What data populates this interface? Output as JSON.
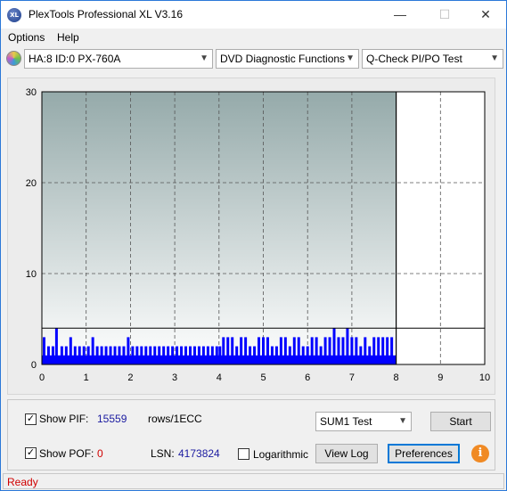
{
  "window": {
    "title": "PlexTools Professional XL V3.16",
    "icon_text": "XL",
    "minimize": "—",
    "maximize": "☐",
    "close": "✕"
  },
  "menu": [
    "Options",
    "Help"
  ],
  "toolbar": {
    "drive": "HA:8 ID:0  PX-760A",
    "function": "DVD Diagnostic Functions",
    "test": "Q-Check PI/PO Test"
  },
  "chart_data": {
    "type": "bar",
    "xlim": [
      0,
      10
    ],
    "ylim": [
      0,
      30
    ],
    "x_ticks": [
      "0",
      "1",
      "2",
      "3",
      "4",
      "5",
      "6",
      "7",
      "8",
      "9",
      "10"
    ],
    "y_ticks": [
      "0",
      "10",
      "20",
      "30"
    ],
    "grid": true,
    "scan_end_x": 8.0,
    "threshold_y": 4,
    "series": [
      {
        "color": "#0000ff",
        "x": [
          0.05,
          0.15,
          0.25,
          0.33,
          0.45,
          0.55,
          0.65,
          0.75,
          0.85,
          0.95,
          1.05,
          1.15,
          1.25,
          1.35,
          1.45,
          1.55,
          1.65,
          1.75,
          1.85,
          1.95,
          2.05,
          2.15,
          2.25,
          2.35,
          2.45,
          2.55,
          2.65,
          2.75,
          2.85,
          2.95,
          3.05,
          3.15,
          3.25,
          3.35,
          3.45,
          3.55,
          3.65,
          3.75,
          3.85,
          3.95,
          4.02,
          4.1,
          4.2,
          4.3,
          4.4,
          4.5,
          4.6,
          4.7,
          4.8,
          4.9,
          5.0,
          5.1,
          5.2,
          5.3,
          5.4,
          5.5,
          5.6,
          5.7,
          5.8,
          5.9,
          6.0,
          6.1,
          6.2,
          6.3,
          6.4,
          6.5,
          6.6,
          6.7,
          6.8,
          6.9,
          7.0,
          7.1,
          7.2,
          7.3,
          7.4,
          7.5,
          7.6,
          7.7,
          7.8,
          7.9
        ],
        "values": [
          3,
          2,
          2,
          4,
          2,
          2,
          3,
          2,
          2,
          2,
          2,
          3,
          2,
          2,
          2,
          2,
          2,
          2,
          2,
          3,
          2,
          2,
          2,
          2,
          2,
          2,
          2,
          2,
          2,
          2,
          2,
          2,
          2,
          2,
          2,
          2,
          2,
          2,
          2,
          2,
          2,
          3,
          3,
          3,
          2,
          3,
          3,
          2,
          2,
          3,
          3,
          3,
          2,
          2,
          3,
          3,
          2,
          3,
          3,
          2,
          2,
          3,
          3,
          2,
          3,
          3,
          4,
          3,
          3,
          4,
          3,
          3,
          2,
          3,
          2,
          3,
          3,
          3,
          3,
          3
        ]
      }
    ]
  },
  "bottom": {
    "show_pif_label": "Show PIF:",
    "pif_value": "15559",
    "pif_unit": "rows/1ECC",
    "show_pof_label": "Show POF:",
    "pof_value": "0",
    "lsn_label": "LSN:",
    "lsn_value": "4173824",
    "logarithmic_label": "Logarithmic",
    "test_select": "SUM1 Test",
    "start_label": "Start",
    "view_log_label": "View Log",
    "preferences_label": "Preferences",
    "info_label": "i",
    "check_mark": "✓"
  },
  "status": "Ready",
  "colors": {
    "accent": "#0078d7",
    "series": "#0000ff",
    "pif_value": "#1a1aa0",
    "pof_value": "#d00000",
    "status": "#d00000"
  }
}
